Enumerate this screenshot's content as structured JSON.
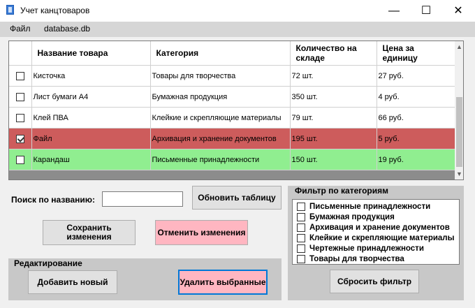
{
  "window": {
    "title": "Учет канцтоваров",
    "minimize": "—",
    "maximize": "☐",
    "close": "✕"
  },
  "menu": {
    "file": "Файл",
    "database": "database.db"
  },
  "table": {
    "headers": [
      "",
      "Название товара",
      "Категория",
      "Количество на складе",
      "Цена за единицу"
    ],
    "rows": [
      {
        "checked": false,
        "name": "Кисточка",
        "category": "Товары для творчества",
        "qty": "72 шт.",
        "price": "27 руб.",
        "color": "white"
      },
      {
        "checked": false,
        "name": "Лист бумаги А4",
        "category": "Бумажная продукция",
        "qty": "350 шт.",
        "price": "4 руб.",
        "color": "white"
      },
      {
        "checked": false,
        "name": "Клей ПВА",
        "category": "Клейкие и скрепляющие материалы",
        "qty": "79 шт.",
        "price": "66 руб.",
        "color": "white"
      },
      {
        "checked": true,
        "name": "Файл",
        "category": "Архивация и хранение документов",
        "qty": "195 шт.",
        "price": "5 руб.",
        "color": "red"
      },
      {
        "checked": false,
        "name": "Карандаш",
        "category": "Письменные принадлежности",
        "qty": "150 шт.",
        "price": "19 руб.",
        "color": "green"
      }
    ],
    "row_colors": {
      "red": "#cd5c5c",
      "green": "#90ee90",
      "white": "#ffffff"
    }
  },
  "search": {
    "label": "Поиск по названию:",
    "value": "",
    "refresh_button": "Обновить таблицу"
  },
  "actions": {
    "save_button": "Сохранить изменения",
    "cancel_button": "Отменить изменения"
  },
  "edit_group": {
    "title": "Редактирование",
    "add_button": "Добавить новый",
    "delete_button": "Удалить выбранные"
  },
  "filter_group": {
    "title": "Фильтр по категориям",
    "categories": [
      "Письменные принадлежности",
      "Бумажная продукция",
      "Архивация и хранение документов",
      "Клейкие и скрепляющие материалы",
      "Чертежные принадлежности",
      "Товары для творчества"
    ],
    "reset_button": "Сбросить фильтр"
  }
}
